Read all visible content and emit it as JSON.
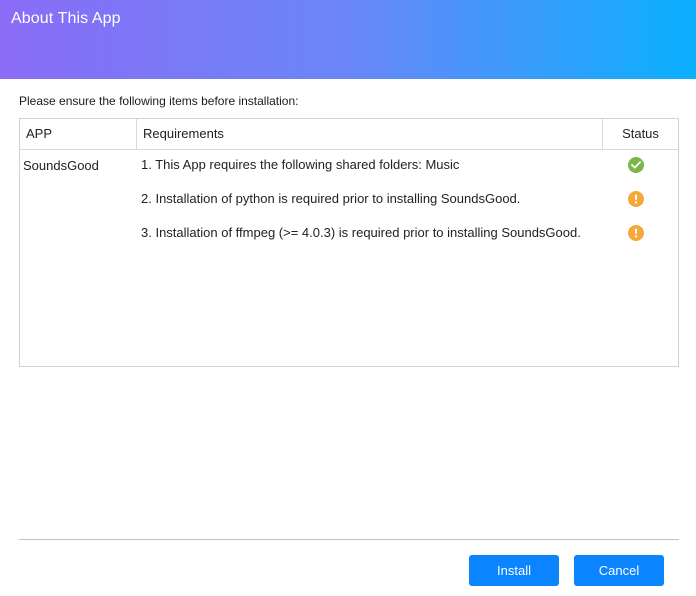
{
  "dialog": {
    "title": "About This App",
    "instruction": "Please ensure the following items before installation:"
  },
  "table": {
    "headers": {
      "app": "APP",
      "requirements": "Requirements",
      "status": "Status"
    },
    "app_name": "SoundsGood",
    "rows": [
      {
        "requirement": "1. This App requires the following shared folders: Music",
        "status": "ok",
        "status_icon": "check-circle-icon"
      },
      {
        "requirement": "2. Installation of python is required prior to installing SoundsGood.",
        "status": "warning",
        "status_icon": "exclamation-circle-icon"
      },
      {
        "requirement": "3. Installation of ffmpeg (>= 4.0.3) is required prior to installing SoundsGood.",
        "status": "warning",
        "status_icon": "exclamation-circle-icon"
      }
    ]
  },
  "buttons": {
    "install": "Install",
    "cancel": "Cancel"
  },
  "colors": {
    "header_gradient_start": "#8a6cf6",
    "header_gradient_end": "#0ab0fe",
    "button": "#0a84ff",
    "status_ok": "#7ab648",
    "status_warning": "#f5a83a"
  }
}
